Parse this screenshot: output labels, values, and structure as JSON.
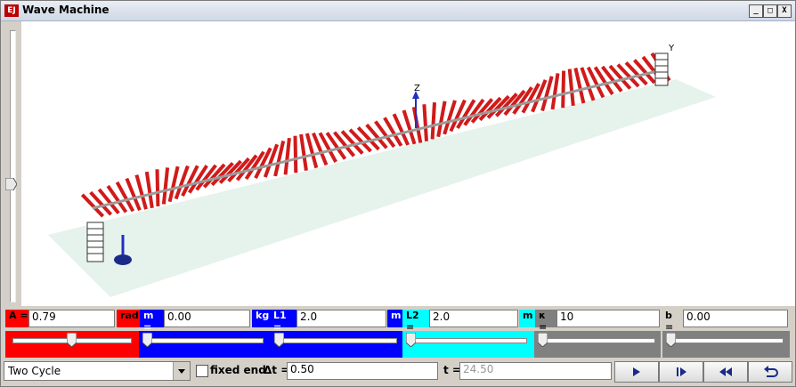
{
  "window": {
    "title": "Wave Machine",
    "icon_text": "EJ",
    "min_label": "_",
    "max_label": "□",
    "close_label": "X"
  },
  "scene": {
    "axis_z": "Z",
    "axis_y": "Y",
    "colors": {
      "rod": "#d11a1a",
      "plane": "#dfeee6",
      "spine": "#9a9a9a"
    }
  },
  "params": {
    "A": {
      "label": "A =",
      "value": "0.79",
      "unit": "rad",
      "color": "#ff0000"
    },
    "m": {
      "label": "m =",
      "value": "0.00",
      "unit": "kg",
      "color": "#0000ff"
    },
    "L1": {
      "label": "L1 =",
      "value": "2.0",
      "unit": "m",
      "color": "#0000ff"
    },
    "L2": {
      "label": "L2 =",
      "value": "2.0",
      "unit": "m",
      "color": "#00ffff"
    },
    "kappa": {
      "label": "κ =",
      "value": "10",
      "color": "#808080"
    },
    "b": {
      "label": "b =",
      "value": "0.00",
      "color": "#d4d0c8"
    }
  },
  "sliders": [
    {
      "name": "A",
      "level": 0.51,
      "color": "#ff0000"
    },
    {
      "name": "m",
      "level": 0.0,
      "color": "#0000ff"
    },
    {
      "name": "L1",
      "level": 0.0,
      "color": "#0000ff"
    },
    {
      "name": "L2",
      "level": 0.0,
      "color": "#00ffff"
    },
    {
      "name": "kappa",
      "level": 0.0,
      "color": "#808080"
    },
    {
      "name": "b",
      "level": 0.0,
      "color": "#808080"
    }
  ],
  "controls": {
    "mode": "Two Cycle",
    "fixed_end_label": "fixed end",
    "dt_label": "Δt =",
    "dt_value": "0.50",
    "t_label": "t =",
    "t_value": "24.50"
  },
  "vertical_slider_level": 0.55
}
